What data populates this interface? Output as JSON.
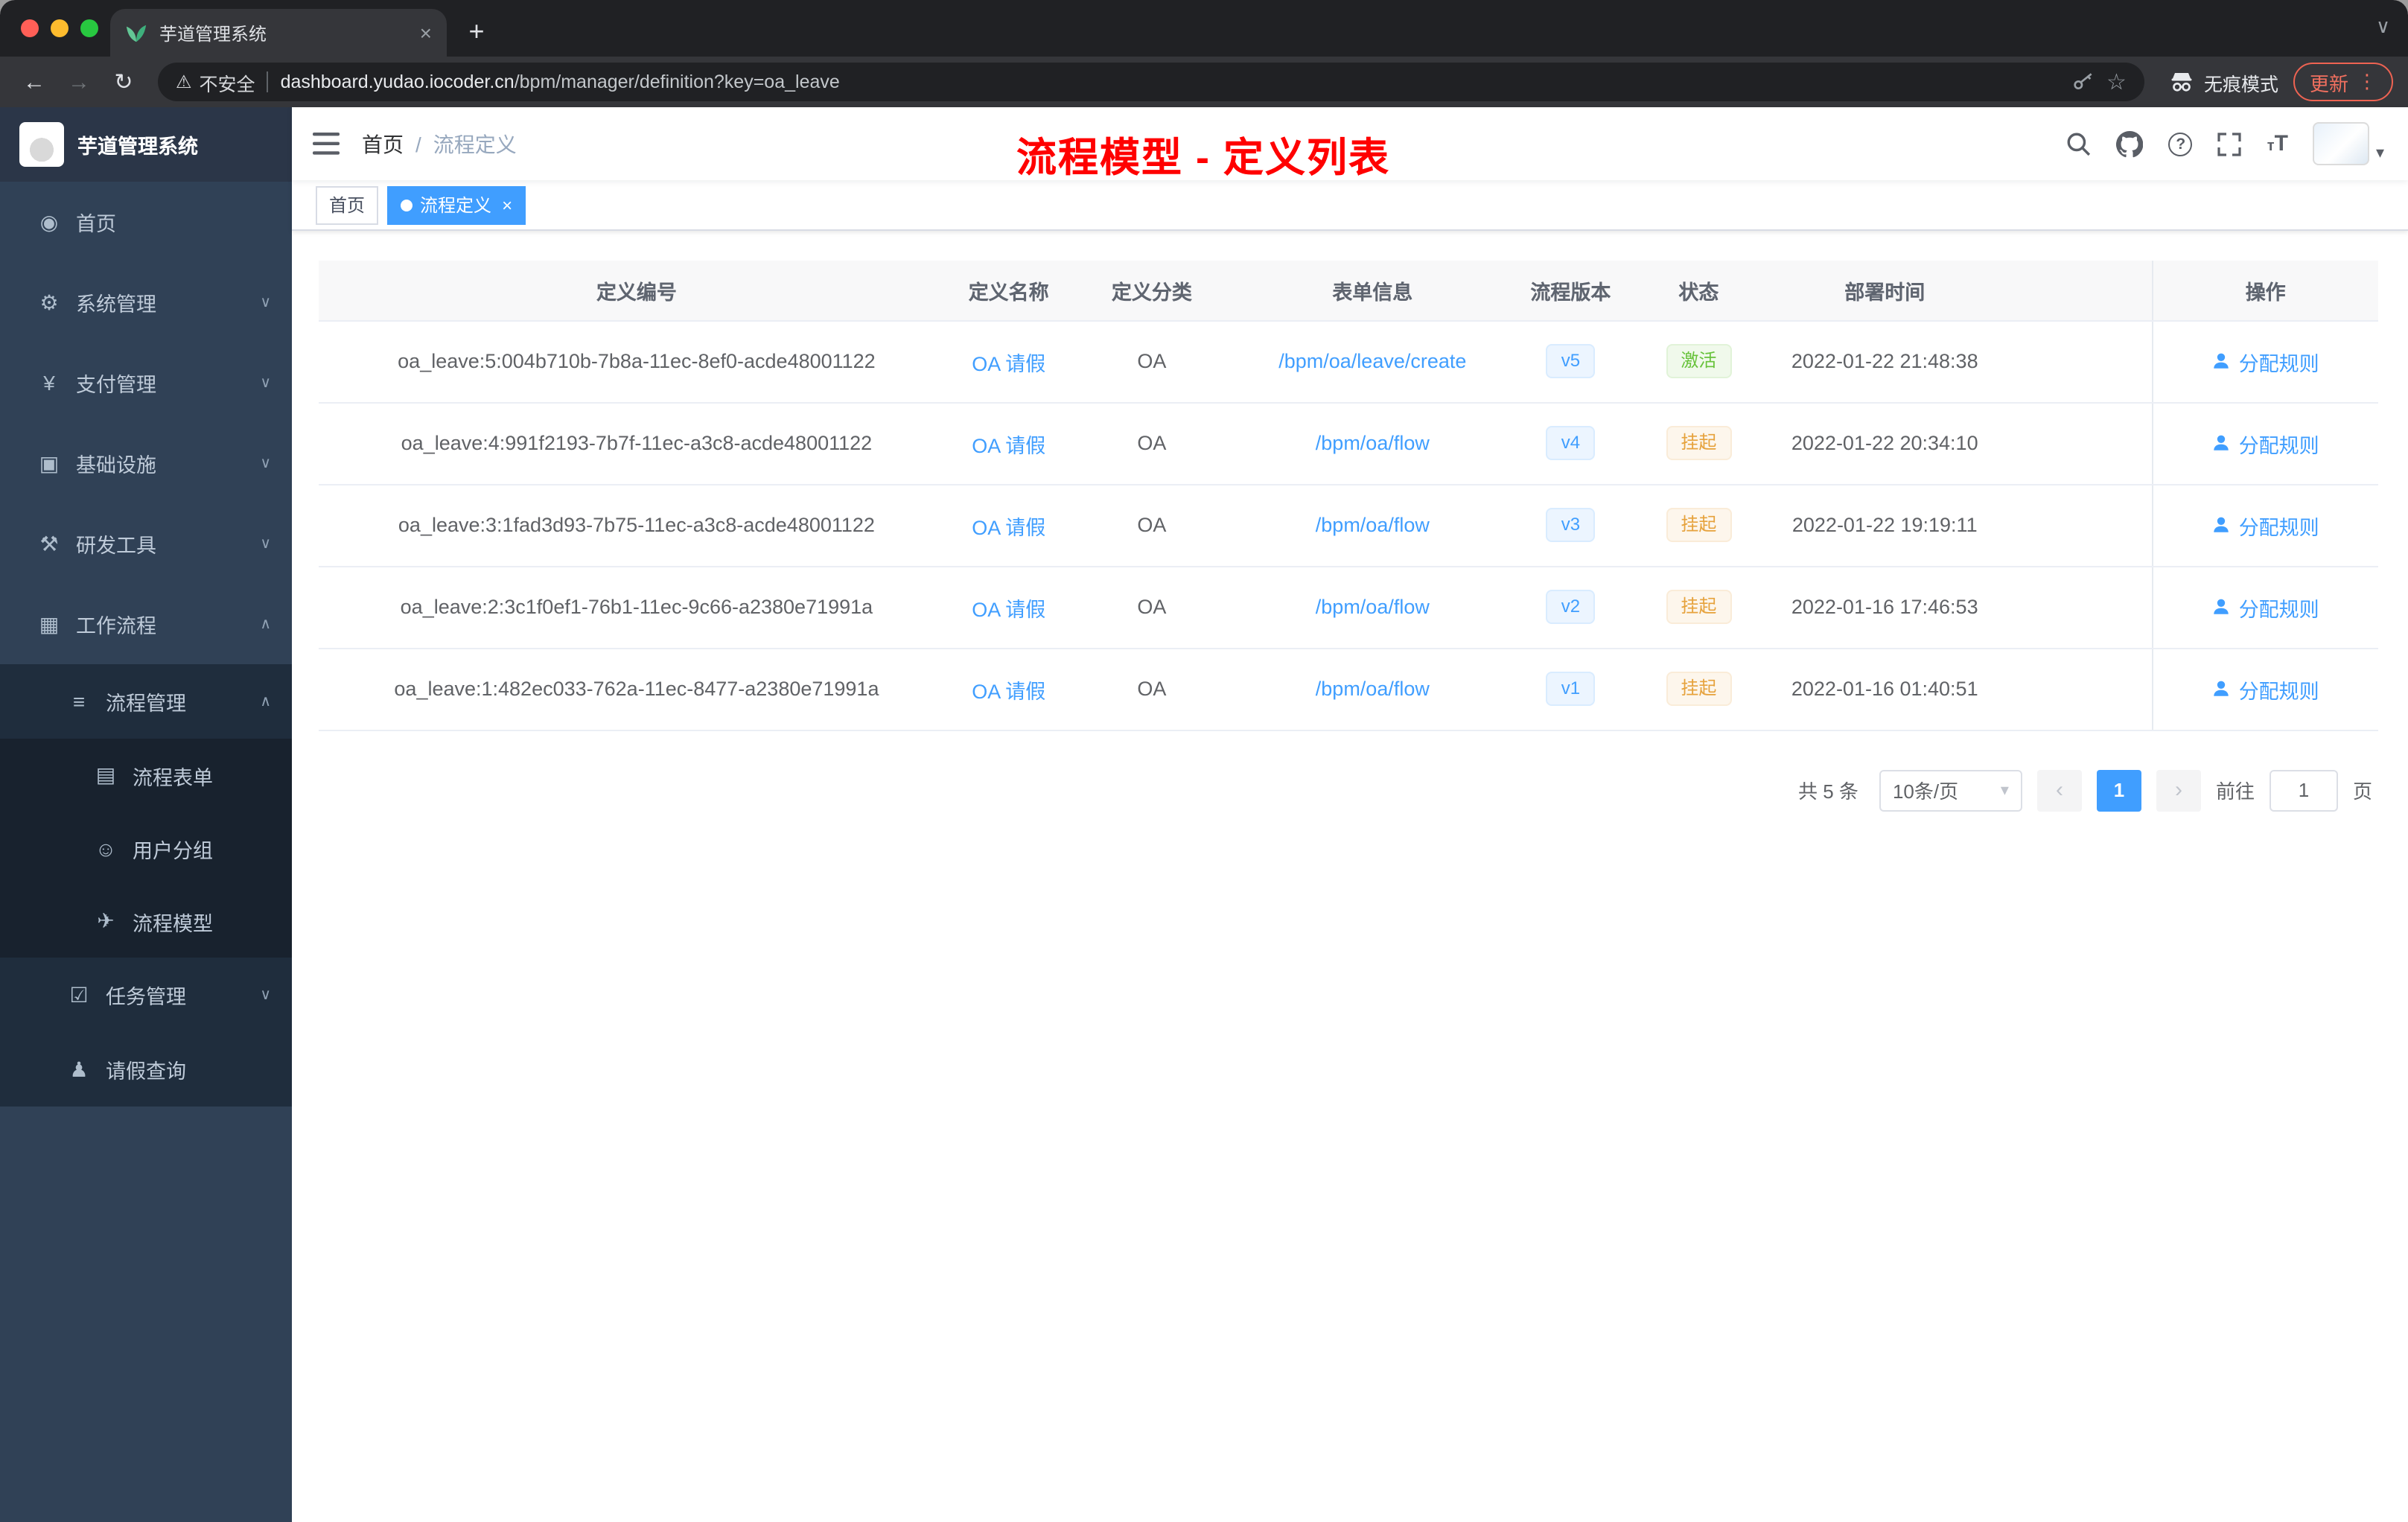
{
  "browser": {
    "tab_title": "芋道管理系统",
    "security_label": "不安全",
    "url_host": "dashboard.yudao.iocoder.cn",
    "url_path": "/bpm/manager/definition?key=oa_leave",
    "incognito_label": "无痕模式",
    "update_label": "更新"
  },
  "icons": {
    "back": "←",
    "forward": "→",
    "reload": "↻",
    "star": "☆",
    "warning": "⚠",
    "more": "⋮",
    "caret_down": "▾",
    "chevron_down": "∨",
    "chevron_up": "∧",
    "plus": "+",
    "close": "×",
    "prev": "‹",
    "next": "›",
    "font_small": "т",
    "font_large": "T",
    "help": "?"
  },
  "colors": {
    "accent": "#409eff",
    "success": "#67c23a",
    "warning": "#e6a23c",
    "annotation": "#ff0000",
    "sidebar_bg": "#304156"
  },
  "sidebar": {
    "logo_title": "芋道管理系统",
    "items": [
      {
        "label": "首页",
        "glyph": "◉"
      },
      {
        "label": "系统管理",
        "glyph": "⚙"
      },
      {
        "label": "支付管理",
        "glyph": "¥"
      },
      {
        "label": "基础设施",
        "glyph": "▣"
      },
      {
        "label": "研发工具",
        "glyph": "⚒"
      },
      {
        "label": "工作流程",
        "glyph": "▦"
      },
      {
        "label": "流程管理",
        "glyph": "≡"
      },
      {
        "label": "流程表单",
        "glyph": "▤"
      },
      {
        "label": "用户分组",
        "glyph": "☺"
      },
      {
        "label": "流程模型",
        "glyph": "✈"
      },
      {
        "label": "任务管理",
        "glyph": "☑"
      },
      {
        "label": "请假查询",
        "glyph": "♟"
      }
    ]
  },
  "header": {
    "breadcrumb_home": "首页",
    "breadcrumb_separator": "/",
    "breadcrumb_current": "流程定义",
    "annotation": "流程模型 - 定义列表"
  },
  "tags": {
    "home": "首页",
    "active": "流程定义"
  },
  "table": {
    "columns": [
      "定义编号",
      "定义名称",
      "定义分类",
      "表单信息",
      "流程版本",
      "状态",
      "部署时间",
      "操作"
    ],
    "rows": [
      {
        "id": "oa_leave:5:004b710b-7b8a-11ec-8ef0-acde48001122",
        "name": "OA 请假",
        "category": "OA",
        "form": "/bpm/oa/leave/create",
        "version": "v5",
        "status": "激活",
        "time": "2022-01-22 21:48:38",
        "action": "分配规则"
      },
      {
        "id": "oa_leave:4:991f2193-7b7f-11ec-a3c8-acde48001122",
        "name": "OA 请假",
        "category": "OA",
        "form": "/bpm/oa/flow",
        "version": "v4",
        "status": "挂起",
        "time": "2022-01-22 20:34:10",
        "action": "分配规则"
      },
      {
        "id": "oa_leave:3:1fad3d93-7b75-11ec-a3c8-acde48001122",
        "name": "OA 请假",
        "category": "OA",
        "form": "/bpm/oa/flow",
        "version": "v3",
        "status": "挂起",
        "time": "2022-01-22 19:19:11",
        "action": "分配规则"
      },
      {
        "id": "oa_leave:2:3c1f0ef1-76b1-11ec-9c66-a2380e71991a",
        "name": "OA 请假",
        "category": "OA",
        "form": "/bpm/oa/flow",
        "version": "v2",
        "status": "挂起",
        "time": "2022-01-16 17:46:53",
        "action": "分配规则"
      },
      {
        "id": "oa_leave:1:482ec033-762a-11ec-8477-a2380e71991a",
        "name": "OA 请假",
        "category": "OA",
        "form": "/bpm/oa/flow",
        "version": "v1",
        "status": "挂起",
        "time": "2022-01-16 01:40:51",
        "action": "分配规则"
      }
    ]
  },
  "pagination": {
    "total": "共 5 条",
    "page_size": "10条/页",
    "page": "1",
    "goto_label": "前往",
    "goto_value": "1",
    "page_unit": "页"
  }
}
